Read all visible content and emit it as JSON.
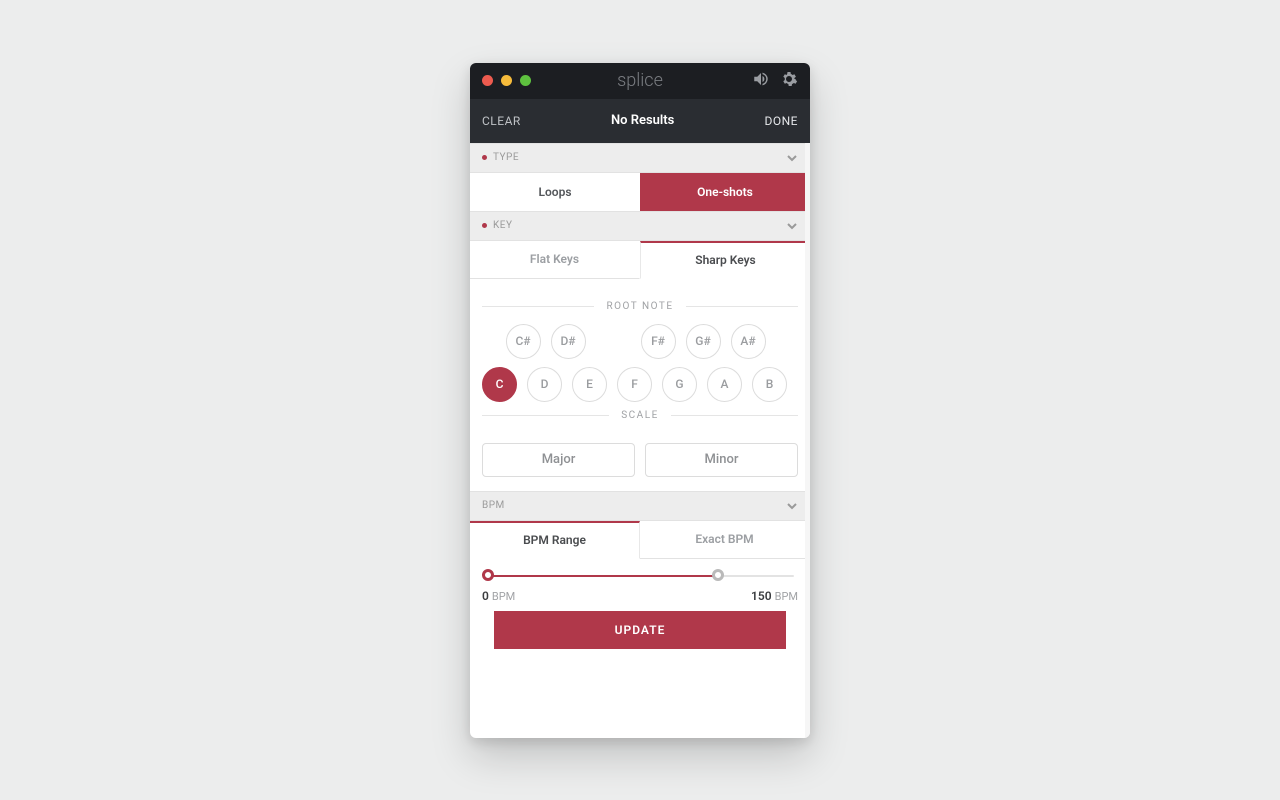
{
  "titlebar": {
    "app_name": "splice"
  },
  "actionbar": {
    "clear": "CLEAR",
    "title": "No Results",
    "done": "DONE"
  },
  "type": {
    "header": "TYPE",
    "options": [
      "Loops",
      "One-shots"
    ],
    "selected": "One-shots"
  },
  "key": {
    "header": "KEY",
    "tabs": [
      "Flat Keys",
      "Sharp Keys"
    ],
    "selected_tab": "Sharp Keys",
    "root_label": "ROOT NOTE",
    "sharps": [
      "C#",
      "D#",
      "F#",
      "G#",
      "A#"
    ],
    "naturals": [
      "C",
      "D",
      "E",
      "F",
      "G",
      "A",
      "B"
    ],
    "selected_note": "C",
    "scale_label": "SCALE",
    "scales": [
      "Major",
      "Minor"
    ]
  },
  "bpm": {
    "header": "BPM",
    "tabs": [
      "BPM Range",
      "Exact BPM"
    ],
    "selected_tab": "BPM Range",
    "min": 0,
    "max": 150,
    "unit": "BPM"
  },
  "buttons": {
    "update": "UPDATE"
  }
}
